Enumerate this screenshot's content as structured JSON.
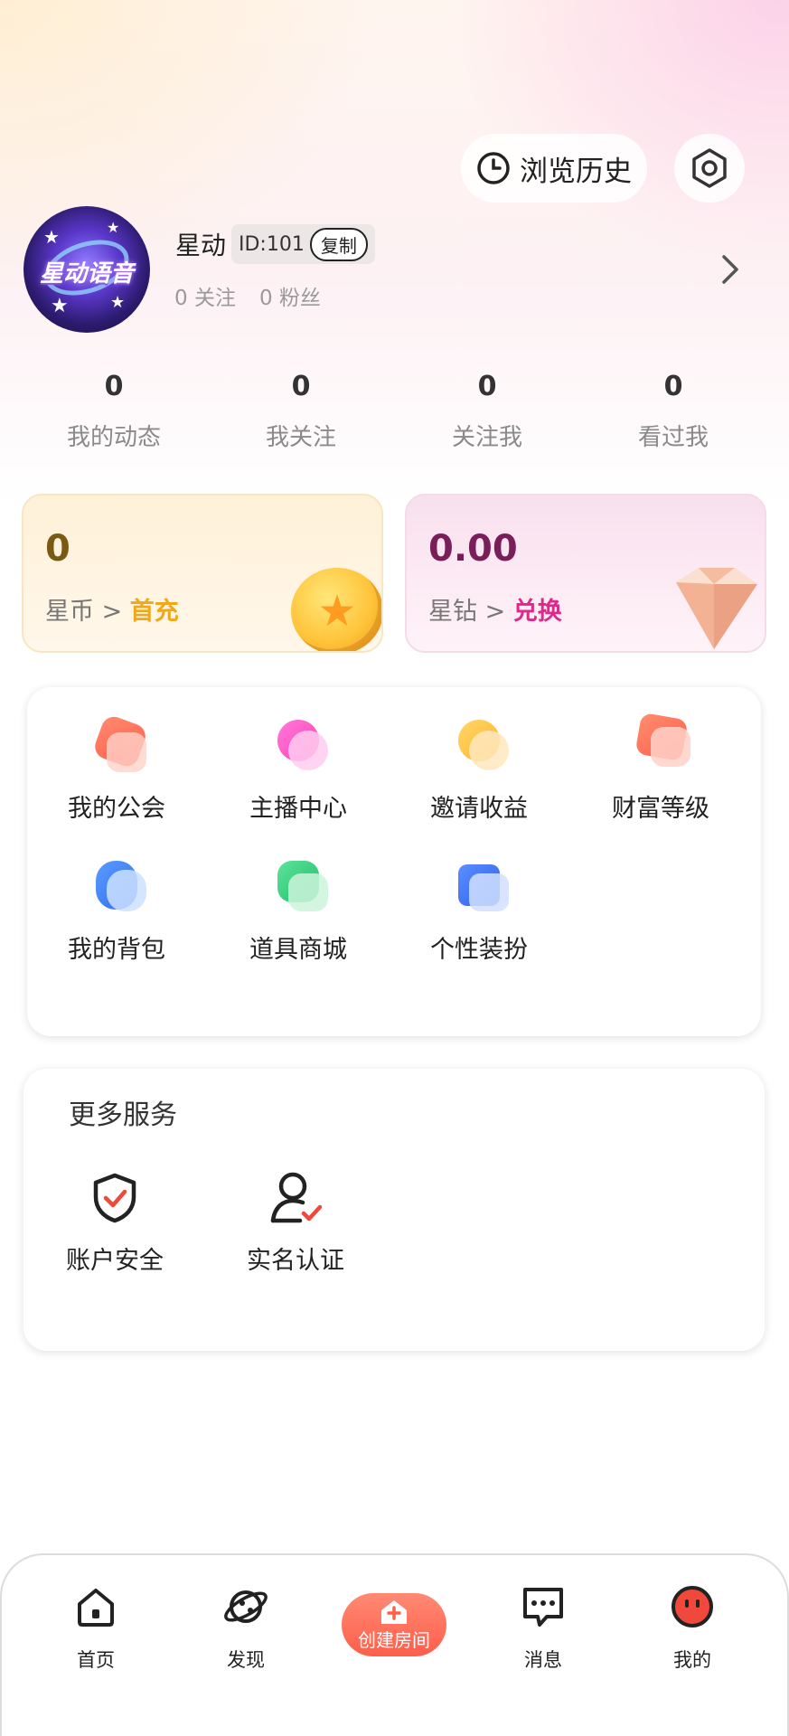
{
  "header": {
    "history_label": "浏览历史"
  },
  "profile": {
    "name": "星动",
    "avatar_text": "星动语音",
    "id_label": "ID:101",
    "copy_label": "复制",
    "following_count": "0",
    "following_label": "关注",
    "fans_count": "0",
    "fans_label": "粉丝"
  },
  "stats": [
    {
      "value": "0",
      "label": "我的动态"
    },
    {
      "value": "0",
      "label": "我关注"
    },
    {
      "value": "0",
      "label": "关注我"
    },
    {
      "value": "0",
      "label": "看过我"
    }
  ],
  "wallet": {
    "coin": {
      "value": "0",
      "label": "星币 > ",
      "action": "首充",
      "color": "#7a5a12",
      "action_color": "#f0a81a"
    },
    "diamond": {
      "value": "0.00",
      "label": "星钻 > ",
      "action": "兑换",
      "color": "#7a1e5a",
      "action_color": "#e0288a"
    }
  },
  "features": [
    {
      "label": "我的公会",
      "icon": "guild-icon"
    },
    {
      "label": "主播中心",
      "icon": "anchor-center-icon"
    },
    {
      "label": "邀请收益",
      "icon": "invite-earnings-icon"
    },
    {
      "label": "财富等级",
      "icon": "wealth-level-icon"
    },
    {
      "label": "我的背包",
      "icon": "backpack-icon"
    },
    {
      "label": "道具商城",
      "icon": "prop-mall-icon"
    },
    {
      "label": "个性装扮",
      "icon": "dress-up-icon"
    }
  ],
  "services": {
    "title": "更多服务",
    "items": [
      {
        "label": "账户安全",
        "icon": "shield-check-icon"
      },
      {
        "label": "实名认证",
        "icon": "user-verify-icon"
      }
    ]
  },
  "nav": {
    "home": "首页",
    "discover": "发现",
    "create": "创建房间",
    "messages": "消息",
    "mine": "我的"
  },
  "colors": {
    "accent": "#ff5e4a"
  }
}
